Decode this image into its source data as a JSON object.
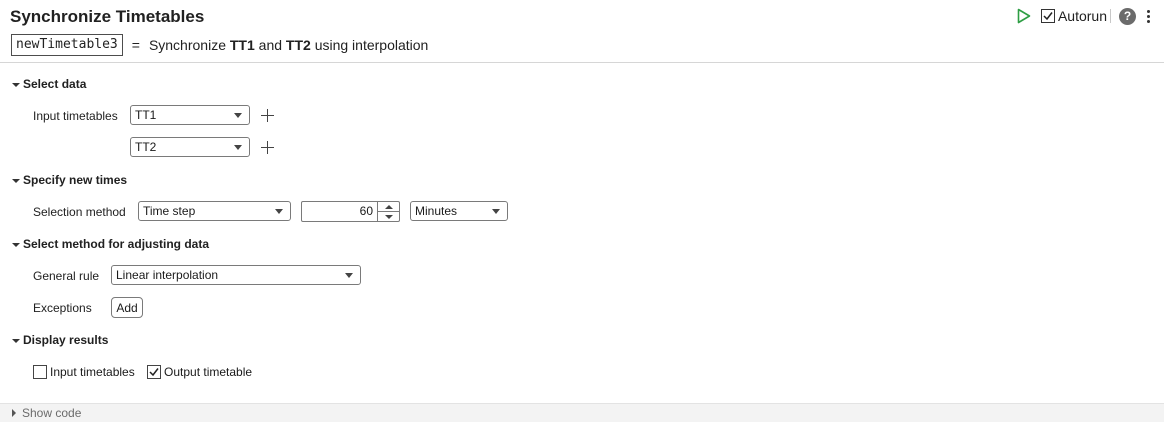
{
  "title": "Synchronize Timetables",
  "toolbar": {
    "autorun_label": "Autorun",
    "autorun_checked": true,
    "help_glyph": "?"
  },
  "summary": {
    "output_var": "newTimetable3",
    "equals": "=",
    "text_prefix": "Synchronize",
    "tt1": "TT1",
    "text_and": "and",
    "tt2": "TT2",
    "text_suffix": "using interpolation"
  },
  "sections": {
    "select_data": {
      "title": "Select data",
      "input_label": "Input timetables",
      "tt_dropdown_1": "TT1",
      "tt_dropdown_2": "TT2"
    },
    "new_times": {
      "title": "Specify new times",
      "method_label": "Selection method",
      "method_value": "Time step",
      "step_value": "60",
      "unit_value": "Minutes"
    },
    "adjust": {
      "title": "Select method for adjusting data",
      "rule_label": "General rule",
      "rule_value": "Linear interpolation",
      "exceptions_label": "Exceptions",
      "add_label": "Add"
    },
    "display": {
      "title": "Display results",
      "input_cb_label": "Input timetables",
      "input_cb_checked": false,
      "output_cb_label": "Output timetable",
      "output_cb_checked": true
    }
  },
  "footer": {
    "show_code": "Show code"
  },
  "icons": {
    "run": "play-icon",
    "help": "help-icon",
    "more": "more-options-icon",
    "add_input": "plus-icon"
  },
  "colors": {
    "run_green": "#2e9e44"
  }
}
